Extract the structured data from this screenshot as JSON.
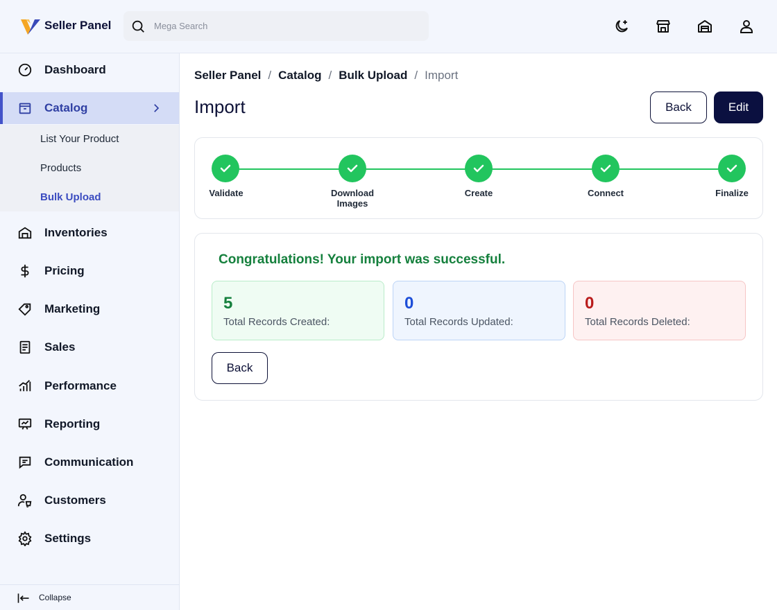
{
  "header": {
    "brand": "Seller Panel",
    "search_placeholder": "Mega Search"
  },
  "sidebar": {
    "items": [
      {
        "label": "Dashboard",
        "icon": "gauge-icon"
      },
      {
        "label": "Catalog",
        "icon": "box-icon",
        "active": true
      },
      {
        "label": "Inventories",
        "icon": "warehouse-icon"
      },
      {
        "label": "Pricing",
        "icon": "dollar-icon"
      },
      {
        "label": "Marketing",
        "icon": "tag-icon"
      },
      {
        "label": "Sales",
        "icon": "receipt-icon"
      },
      {
        "label": "Performance",
        "icon": "bar-chart-icon"
      },
      {
        "label": "Reporting",
        "icon": "presentation-icon"
      },
      {
        "label": "Communication",
        "icon": "message-icon"
      },
      {
        "label": "Customers",
        "icon": "users-icon"
      },
      {
        "label": "Settings",
        "icon": "gear-icon"
      }
    ],
    "catalog_sub": [
      {
        "label": "List Your Product"
      },
      {
        "label": "Products"
      },
      {
        "label": "Bulk Upload",
        "active": true
      }
    ],
    "collapse_label": "Collapse"
  },
  "breadcrumb": [
    "Seller Panel",
    "Catalog",
    "Bulk Upload",
    "Import"
  ],
  "page_title": "Import",
  "actions": {
    "back": "Back",
    "edit": "Edit"
  },
  "steps": [
    {
      "label": "Validate"
    },
    {
      "label": "Download Images"
    },
    {
      "label": "Create"
    },
    {
      "label": "Connect"
    },
    {
      "label": "Finalize"
    }
  ],
  "result": {
    "message": "Congratulations! Your import was successful.",
    "created": {
      "value": "5",
      "label": "Total Records Created:"
    },
    "updated": {
      "value": "0",
      "label": "Total Records Updated:"
    },
    "deleted": {
      "value": "0",
      "label": "Total Records Deleted:"
    },
    "back_label": "Back"
  },
  "colors": {
    "primary": "#0b1040",
    "accent": "#4353c9",
    "success": "#22c55e",
    "success_text": "#15803d",
    "info_text": "#1d4ed8",
    "danger_text": "#b91c1c"
  }
}
